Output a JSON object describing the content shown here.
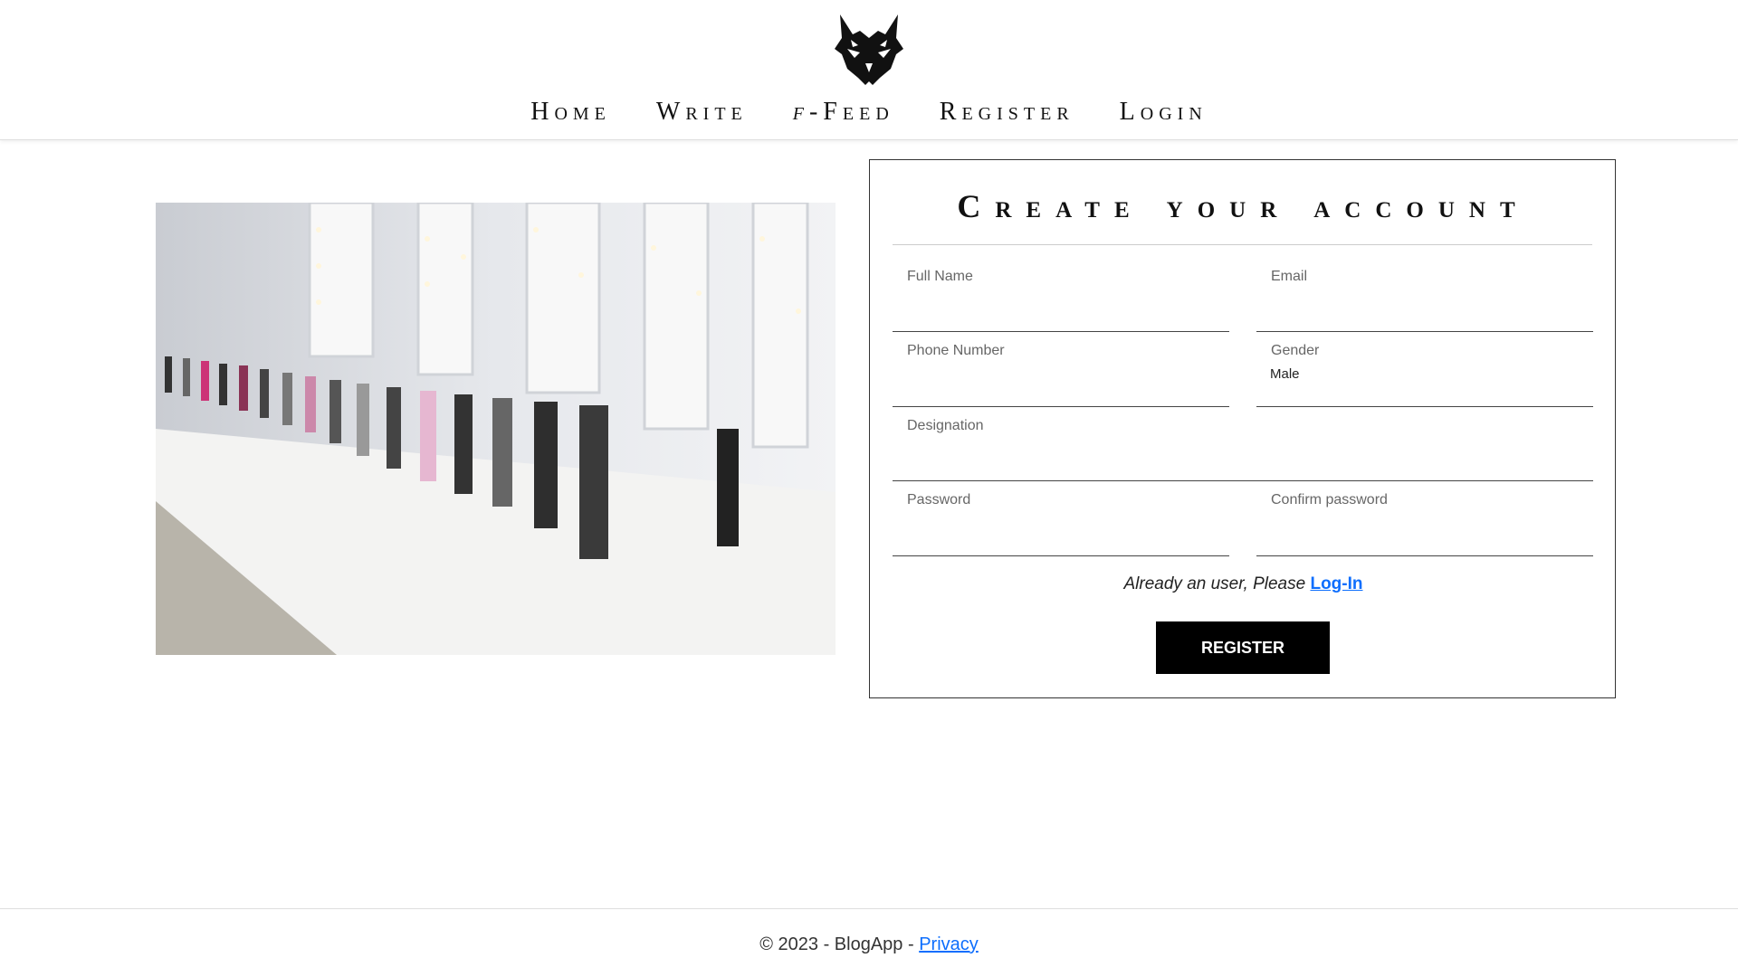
{
  "nav": {
    "home": "Home",
    "write": "Write",
    "ffeed_prefix": "f",
    "ffeed_suffix": "-Feed",
    "register": "Register",
    "login": "Login"
  },
  "form": {
    "title": "Create your account",
    "full_name_label": "Full Name",
    "email_label": "Email",
    "phone_label": "Phone Number",
    "gender_label": "Gender",
    "gender_value": "Male",
    "designation_label": "Designation",
    "password_label": "Password",
    "confirm_password_label": "Confirm password",
    "login_prompt": "Already an user, Please",
    "login_link": "Log-In",
    "register_button": "REGISTER"
  },
  "footer": {
    "copyright": "© 2023 - BlogApp -",
    "privacy_link": "Privacy"
  },
  "colors": {
    "link": "#0d6efd",
    "button_bg": "#000000",
    "button_text": "#ffffff"
  },
  "icons": {
    "logo": "wolf-head-logo-icon"
  }
}
